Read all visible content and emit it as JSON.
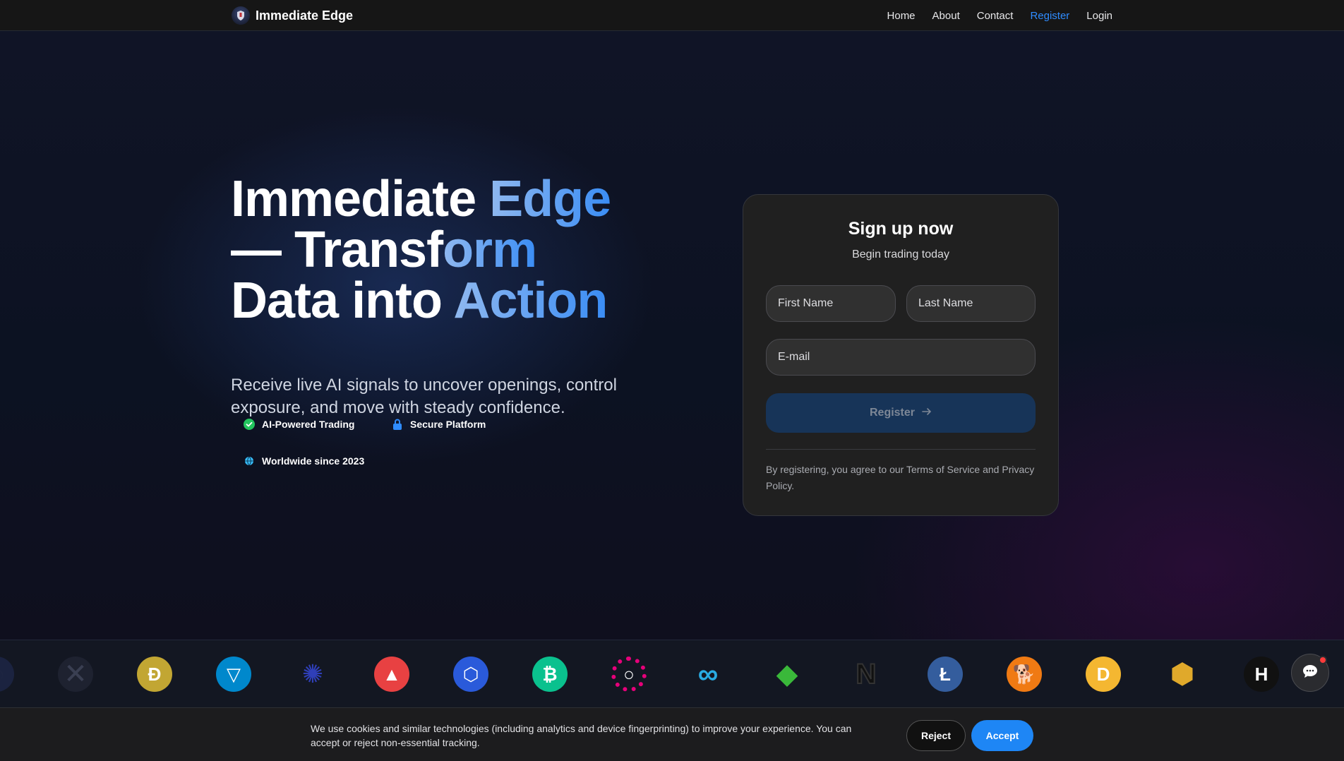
{
  "nav": {
    "brand": "Immediate Edge",
    "links": [
      "Home",
      "About",
      "Contact",
      "Register",
      "Login"
    ],
    "active": "Register"
  },
  "hero": {
    "headline": {
      "l1a": "Immediate ",
      "l1b": "Edge",
      "l2a": "— Transf",
      "l2b": "orm",
      "l3a": "Data into ",
      "l3b": "Action"
    },
    "subtitle": "Receive live AI signals to uncover openings, control exposure, and move with steady confidence.",
    "badges": [
      "AI-Powered Trading",
      "Secure Platform",
      "Worldwide since 2023"
    ]
  },
  "signup": {
    "title": "Sign up now",
    "subtitle": "Begin trading today",
    "first_name_placeholder": "First Name",
    "last_name_placeholder": "Last Name",
    "email_placeholder": "E-mail",
    "register_label": "Register",
    "terms": "By registering, you agree to our Terms of Service and Privacy Policy."
  },
  "coins": [
    {
      "name": "moon-coin-icon",
      "color": "#1b2340"
    },
    {
      "name": "x-coin-icon",
      "color": "#1e2230"
    },
    {
      "name": "dogecoin-icon",
      "color": "#c2a633"
    },
    {
      "name": "toncoin-icon",
      "color": "#0088cc"
    },
    {
      "name": "cardano-icon",
      "color": "#1a1f5e"
    },
    {
      "name": "avalanche-icon",
      "color": "#e84142"
    },
    {
      "name": "chainlink-icon",
      "color": "#2a5ada"
    },
    {
      "name": "bitcoin-cash-icon",
      "color": "#0ac18e"
    },
    {
      "name": "polkadot-icon",
      "color": "#e6007a"
    },
    {
      "name": "internet-computer-icon",
      "color": "#29abe2"
    },
    {
      "name": "ethereum-classic-icon",
      "color": "#3ab83a"
    },
    {
      "name": "near-icon",
      "color": "#000000"
    },
    {
      "name": "litecoin-icon",
      "color": "#345d9d"
    },
    {
      "name": "shiba-inu-icon",
      "color": "#f07a13"
    },
    {
      "name": "dai-icon",
      "color": "#f4b731"
    },
    {
      "name": "unus-sed-leo-icon",
      "color": "#e0a92b"
    },
    {
      "name": "hedera-icon",
      "color": "#111111"
    }
  ],
  "cookie": {
    "text": "We use cookies and similar technologies (including analytics and device fingerprinting) to improve your experience. You can accept or reject non-essential tracking.",
    "reject": "Reject",
    "accept": "Accept"
  },
  "colors": {
    "accent": "#2f8cff",
    "accept": "#1e86f5",
    "register_button": "#173458"
  }
}
